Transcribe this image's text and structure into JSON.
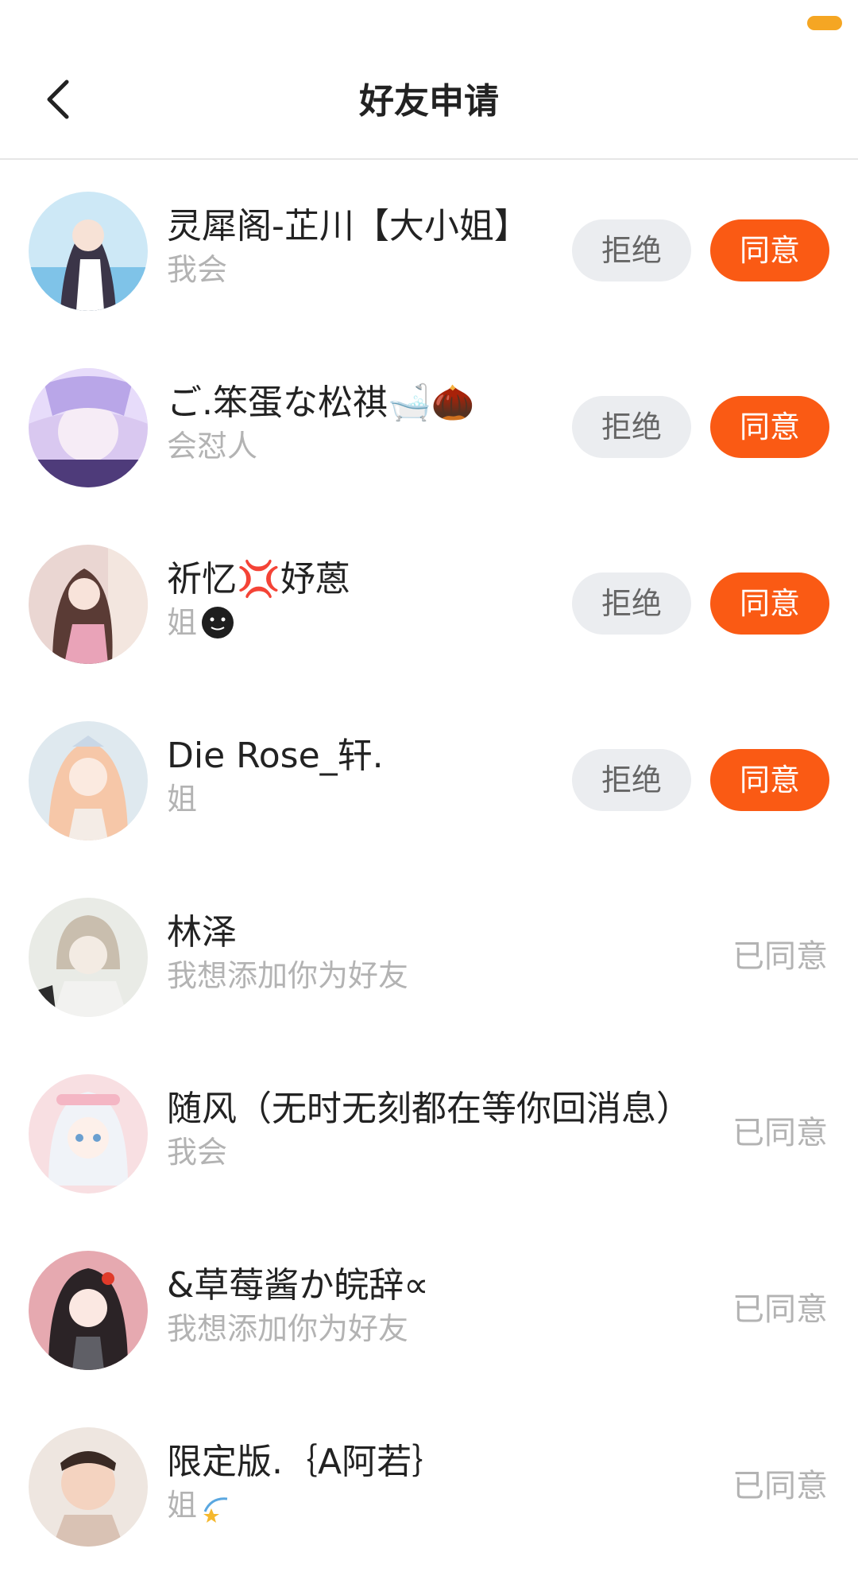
{
  "header": {
    "title": "好友申请",
    "back_icon": "chevron-left-icon"
  },
  "colors": {
    "accent": "#fa5a14",
    "reject_bg": "#ebedf0",
    "secondary_text": "#b3b3b3"
  },
  "labels": {
    "reject": "拒绝",
    "accept": "同意",
    "accepted": "已同意"
  },
  "requests": [
    {
      "name": "灵犀阁-芷川【大小姐】",
      "message": "我会",
      "status": "pending"
    },
    {
      "name": "ご.笨蛋な松祺🛁🌰",
      "message": "会怼人",
      "status": "pending"
    },
    {
      "name": "祈忆💢妤蒽",
      "message": "姐",
      "message_emoji": "black-face-emoji",
      "status": "pending"
    },
    {
      "name": "Die Rose_轩.",
      "message": "姐",
      "status": "pending"
    },
    {
      "name": "林泽",
      "message": "我想添加你为好友",
      "status": "accepted"
    },
    {
      "name": "随风（无时无刻都在等你回消息）",
      "message": "我会",
      "status": "accepted"
    },
    {
      "name": "&草莓酱か皖辞∝",
      "message": "我想添加你为好友",
      "status": "accepted"
    },
    {
      "name": "限定版.｛A阿若｝",
      "message": "姐",
      "message_emoji": "dizzy-star-emoji",
      "status": "accepted"
    }
  ]
}
